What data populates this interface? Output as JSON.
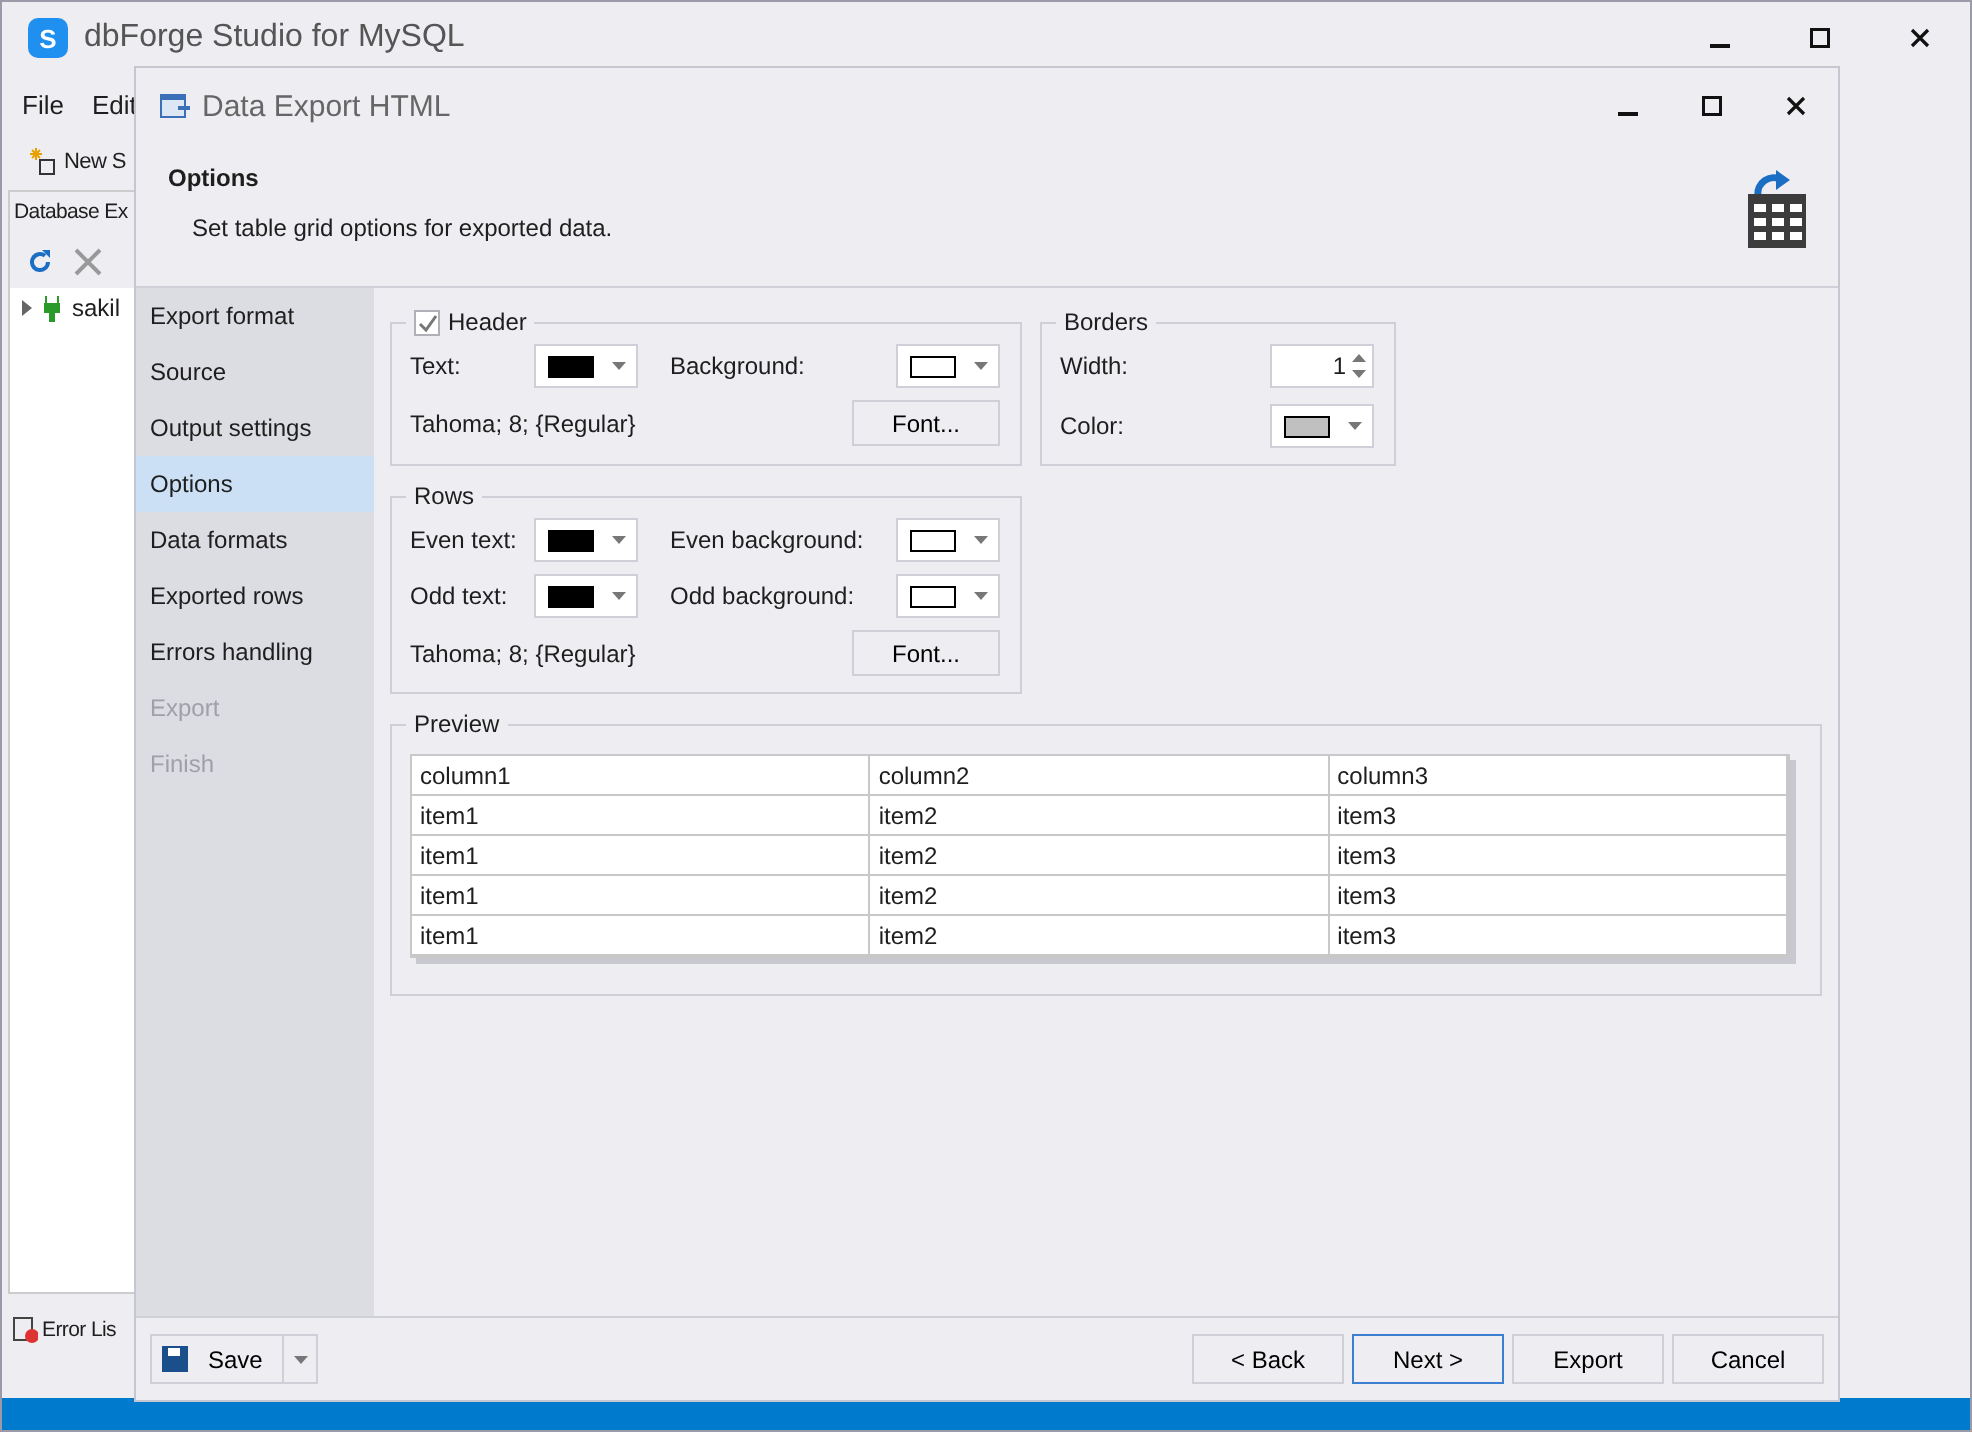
{
  "app": {
    "logo_text": "S",
    "title": "dbForge Studio for MySQL",
    "menu": [
      "File",
      "Edit"
    ],
    "toolbar_button": "New S",
    "explorer": {
      "title": "Database Ex",
      "tree": [
        {
          "label": "sakil",
          "expanded": false
        }
      ]
    },
    "bottom_tab": "Error Lis"
  },
  "dialog": {
    "title": "Data Export HTML",
    "header": {
      "title": "Options",
      "subtitle": "Set table grid options for exported data."
    },
    "steps": [
      {
        "label": "Export format",
        "selected": false,
        "disabled": false
      },
      {
        "label": "Source",
        "selected": false,
        "disabled": false
      },
      {
        "label": "Output settings",
        "selected": false,
        "disabled": false
      },
      {
        "label": "Options",
        "selected": true,
        "disabled": false
      },
      {
        "label": "Data formats",
        "selected": false,
        "disabled": false
      },
      {
        "label": "Exported rows",
        "selected": false,
        "disabled": false
      },
      {
        "label": "Errors handling",
        "selected": false,
        "disabled": false
      },
      {
        "label": "Export",
        "selected": false,
        "disabled": true
      },
      {
        "label": "Finish",
        "selected": false,
        "disabled": true
      }
    ],
    "header_group": {
      "label": "Header",
      "checked": true,
      "fields": [
        {
          "label": "Text:",
          "color": "#000000"
        },
        {
          "label": "Background:",
          "color": "#ffffff"
        }
      ],
      "font": "Tahoma; 8; {Regular}",
      "font_button": "Font..."
    },
    "borders_group": {
      "label": "Borders",
      "width_label": "Width:",
      "width_value": "1",
      "color_label": "Color:",
      "color": "#c0c0c0"
    },
    "rows_group": {
      "label": "Rows",
      "fields": [
        {
          "label": "Even text:",
          "color": "#000000"
        },
        {
          "label": "Even background:",
          "color": "#ffffff"
        },
        {
          "label": "Odd text:",
          "color": "#000000"
        },
        {
          "label": "Odd background:",
          "color": "#ffffff"
        }
      ],
      "font": "Tahoma; 8; {Regular}",
      "font_button": "Font..."
    },
    "preview": {
      "label": "Preview",
      "columns": [
        "column1",
        "column2",
        "column3"
      ],
      "rows": [
        [
          "item1",
          "item2",
          "item3"
        ],
        [
          "item1",
          "item2",
          "item3"
        ],
        [
          "item1",
          "item2",
          "item3"
        ],
        [
          "item1",
          "item2",
          "item3"
        ]
      ]
    },
    "footer": {
      "save": "Save",
      "back": "< Back",
      "next": "Next >",
      "export": "Export",
      "cancel": "Cancel"
    }
  }
}
